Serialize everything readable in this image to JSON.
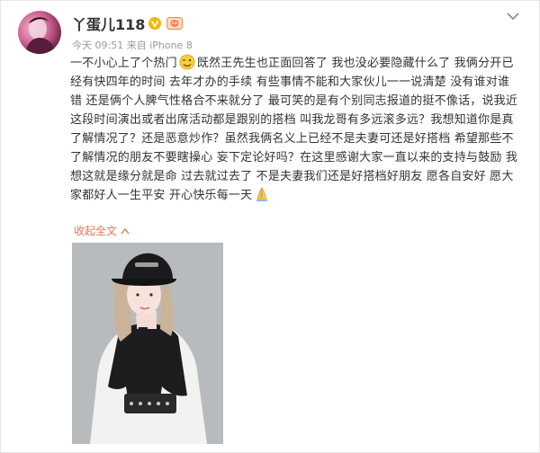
{
  "post": {
    "username": "丫蛋儿118",
    "meta": "今天 09:51 来自 iPhone 8",
    "text_part1": "一不小心上了个热门",
    "text_part2": "既然王先生也正面回答了 我也没必要隐藏什么了 我俩分开已经有快四年的时间 去年才办的手续 有些事情不能和大家伙儿一一说清楚 没有谁对谁错 还是俩个人脾气性格合不来就分了 最可笑的是有个别同志报道的挺不像话，说我近这段时间演出或者出席活动都是跟别的搭档 叫我龙哥有多远滚多远？我想知道你是真了解情况了？还是恶意炒作？虽然我俩名义上已经不是夫妻可还是好搭档 希望那些不了解情况的朋友不要瞎操心 妄下定论好吗？在这里感谢大家一直以来的支持与鼓励 我想这就是缘分就是命 过去就过去了 不是夫妻我们还是好搭档好朋友 愿各自安好 愿大家都好人一生平安 开心快乐每一天",
    "collapse_label": "收起全文",
    "icons": {
      "verified": "verified-v-icon",
      "level": "user-level-icon",
      "face": "wink-face-emoji-icon",
      "pray": "praying-hands-emoji-icon",
      "menu": "chevron-down-icon",
      "collapse": "collapse-arrow-icon"
    },
    "colors": {
      "link": "#eb7350",
      "verified": "#f7b500",
      "meta": "#999999"
    }
  }
}
